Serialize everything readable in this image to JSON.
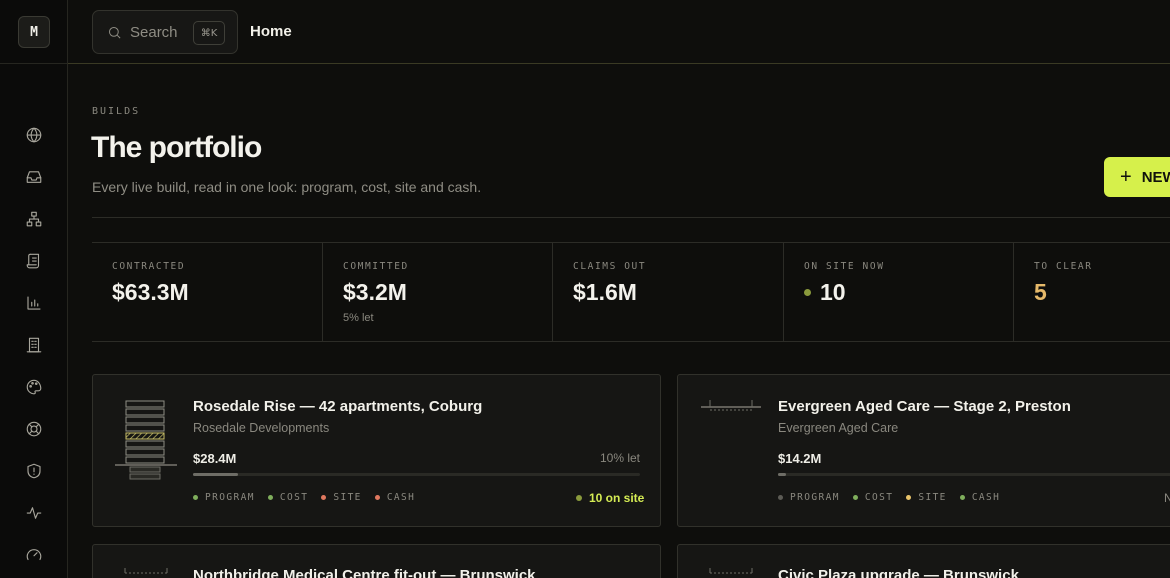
{
  "app": {
    "logo_letter": "M"
  },
  "topbar": {
    "search_label": "Search",
    "search_shortcut": "⌘K",
    "breadcrumb": "Home"
  },
  "sidebar": {
    "icons": [
      "globe-icon",
      "inbox-icon",
      "org-chart-icon",
      "scroll-icon",
      "bar-chart-icon",
      "building-icon",
      "palette-icon",
      "lifebuoy-icon",
      "shield-icon",
      "activity-icon",
      "gauge-icon"
    ]
  },
  "header": {
    "eyebrow": "BUILDS",
    "title": "The portfolio",
    "subtitle": "Every live build, read in one look: program, cost, site and cash.",
    "new_button": "NEW"
  },
  "stats": [
    {
      "label": "CONTRACTED",
      "value": "$63.3M",
      "note": ""
    },
    {
      "label": "COMMITTED",
      "value": "$3.2M",
      "note": "5% let"
    },
    {
      "label": "CLAIMS OUT",
      "value": "$1.6M",
      "note": ""
    },
    {
      "label": "ON SITE NOW",
      "value": "10",
      "note": ""
    },
    {
      "label": "TO CLEAR",
      "value": "5",
      "note": ""
    }
  ],
  "tag_labels": {
    "program": "PROGRAM",
    "cost": "COST",
    "site": "SITE",
    "cash": "CASH"
  },
  "status_colors": {
    "green": "#7fae5c",
    "red": "#e0785f",
    "amber": "#e9c46a",
    "grey": "#5c5b55",
    "accent": "#d6f04b"
  },
  "builds": [
    {
      "name": "Rosedale Rise — 42 apartments, Coburg",
      "client": "Rosedale Developments",
      "amount": "$28.4M",
      "let_label": "10% let",
      "progress": 0.1,
      "statuses": {
        "program": "green",
        "cost": "green",
        "site": "red",
        "cash": "red"
      },
      "onsite": "10 on site"
    },
    {
      "name": "Evergreen Aged Care — Stage 2, Preston",
      "client": "Evergreen Aged Care",
      "amount": "$14.2M",
      "let_label": "",
      "progress": 0.02,
      "statuses": {
        "program": "grey",
        "cost": "green",
        "site": "amber",
        "cash": "green"
      },
      "onsite": "N"
    },
    {
      "name": "Northbridge Medical Centre fit-out — Brunswick"
    },
    {
      "name": "Civic Plaza upgrade — Brunswick"
    }
  ]
}
